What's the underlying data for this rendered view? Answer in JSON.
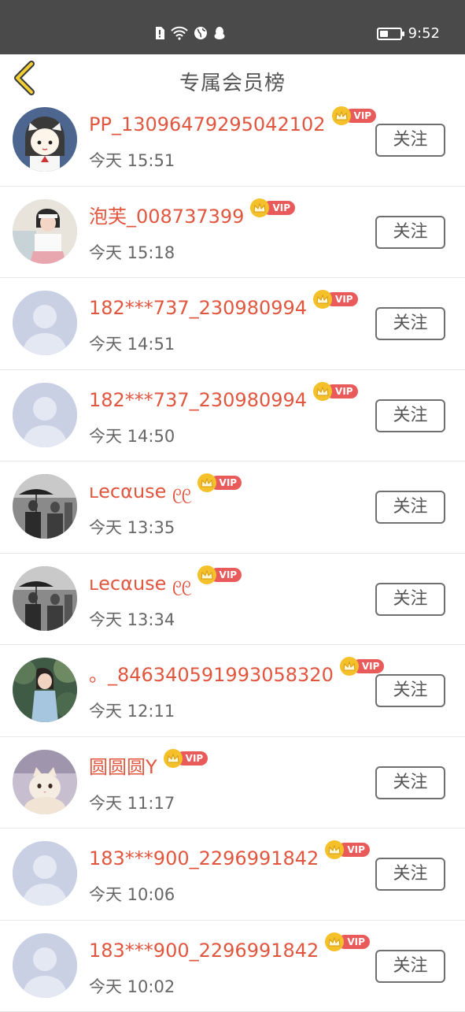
{
  "status": {
    "time": "9:52",
    "battery_level": 0.45
  },
  "header": {
    "title": "专属会员榜"
  },
  "vip_badge": "VIP",
  "colors": {
    "name": "#e0563f",
    "vip": "#e95a5a",
    "crown": "#f5c12a",
    "header_bg": "#4a4a4a"
  },
  "members": [
    {
      "name": "PP_13096479295042102",
      "time": "今天 15:51",
      "follow": "关注",
      "avatar": "cartoon-girl"
    },
    {
      "name": "泡芙_008737399",
      "time": "今天 15:18",
      "follow": "关注",
      "avatar": "photo-girl"
    },
    {
      "name": "182***737_230980994",
      "time": "今天 14:51",
      "follow": "关注",
      "avatar": "default"
    },
    {
      "name": "182***737_230980994",
      "time": "今天 14:50",
      "follow": "关注",
      "avatar": "default"
    },
    {
      "name": "ʟecαuse ᧙᧙",
      "time": "今天 13:35",
      "follow": "关注",
      "avatar": "street-photo"
    },
    {
      "name": "ʟecαuse ᧙᧙",
      "time": "今天 13:34",
      "follow": "关注",
      "avatar": "street-photo"
    },
    {
      "name": "。_846340591993058320",
      "time": "今天 12:11",
      "follow": "关注",
      "avatar": "forest-girl"
    },
    {
      "name": "圆圆圆Y",
      "time": "今天 11:17",
      "follow": "关注",
      "avatar": "cat"
    },
    {
      "name": "183***900_2296991842",
      "time": "今天 10:06",
      "follow": "关注",
      "avatar": "default"
    },
    {
      "name": "183***900_2296991842",
      "time": "今天 10:02",
      "follow": "关注",
      "avatar": "default"
    }
  ]
}
